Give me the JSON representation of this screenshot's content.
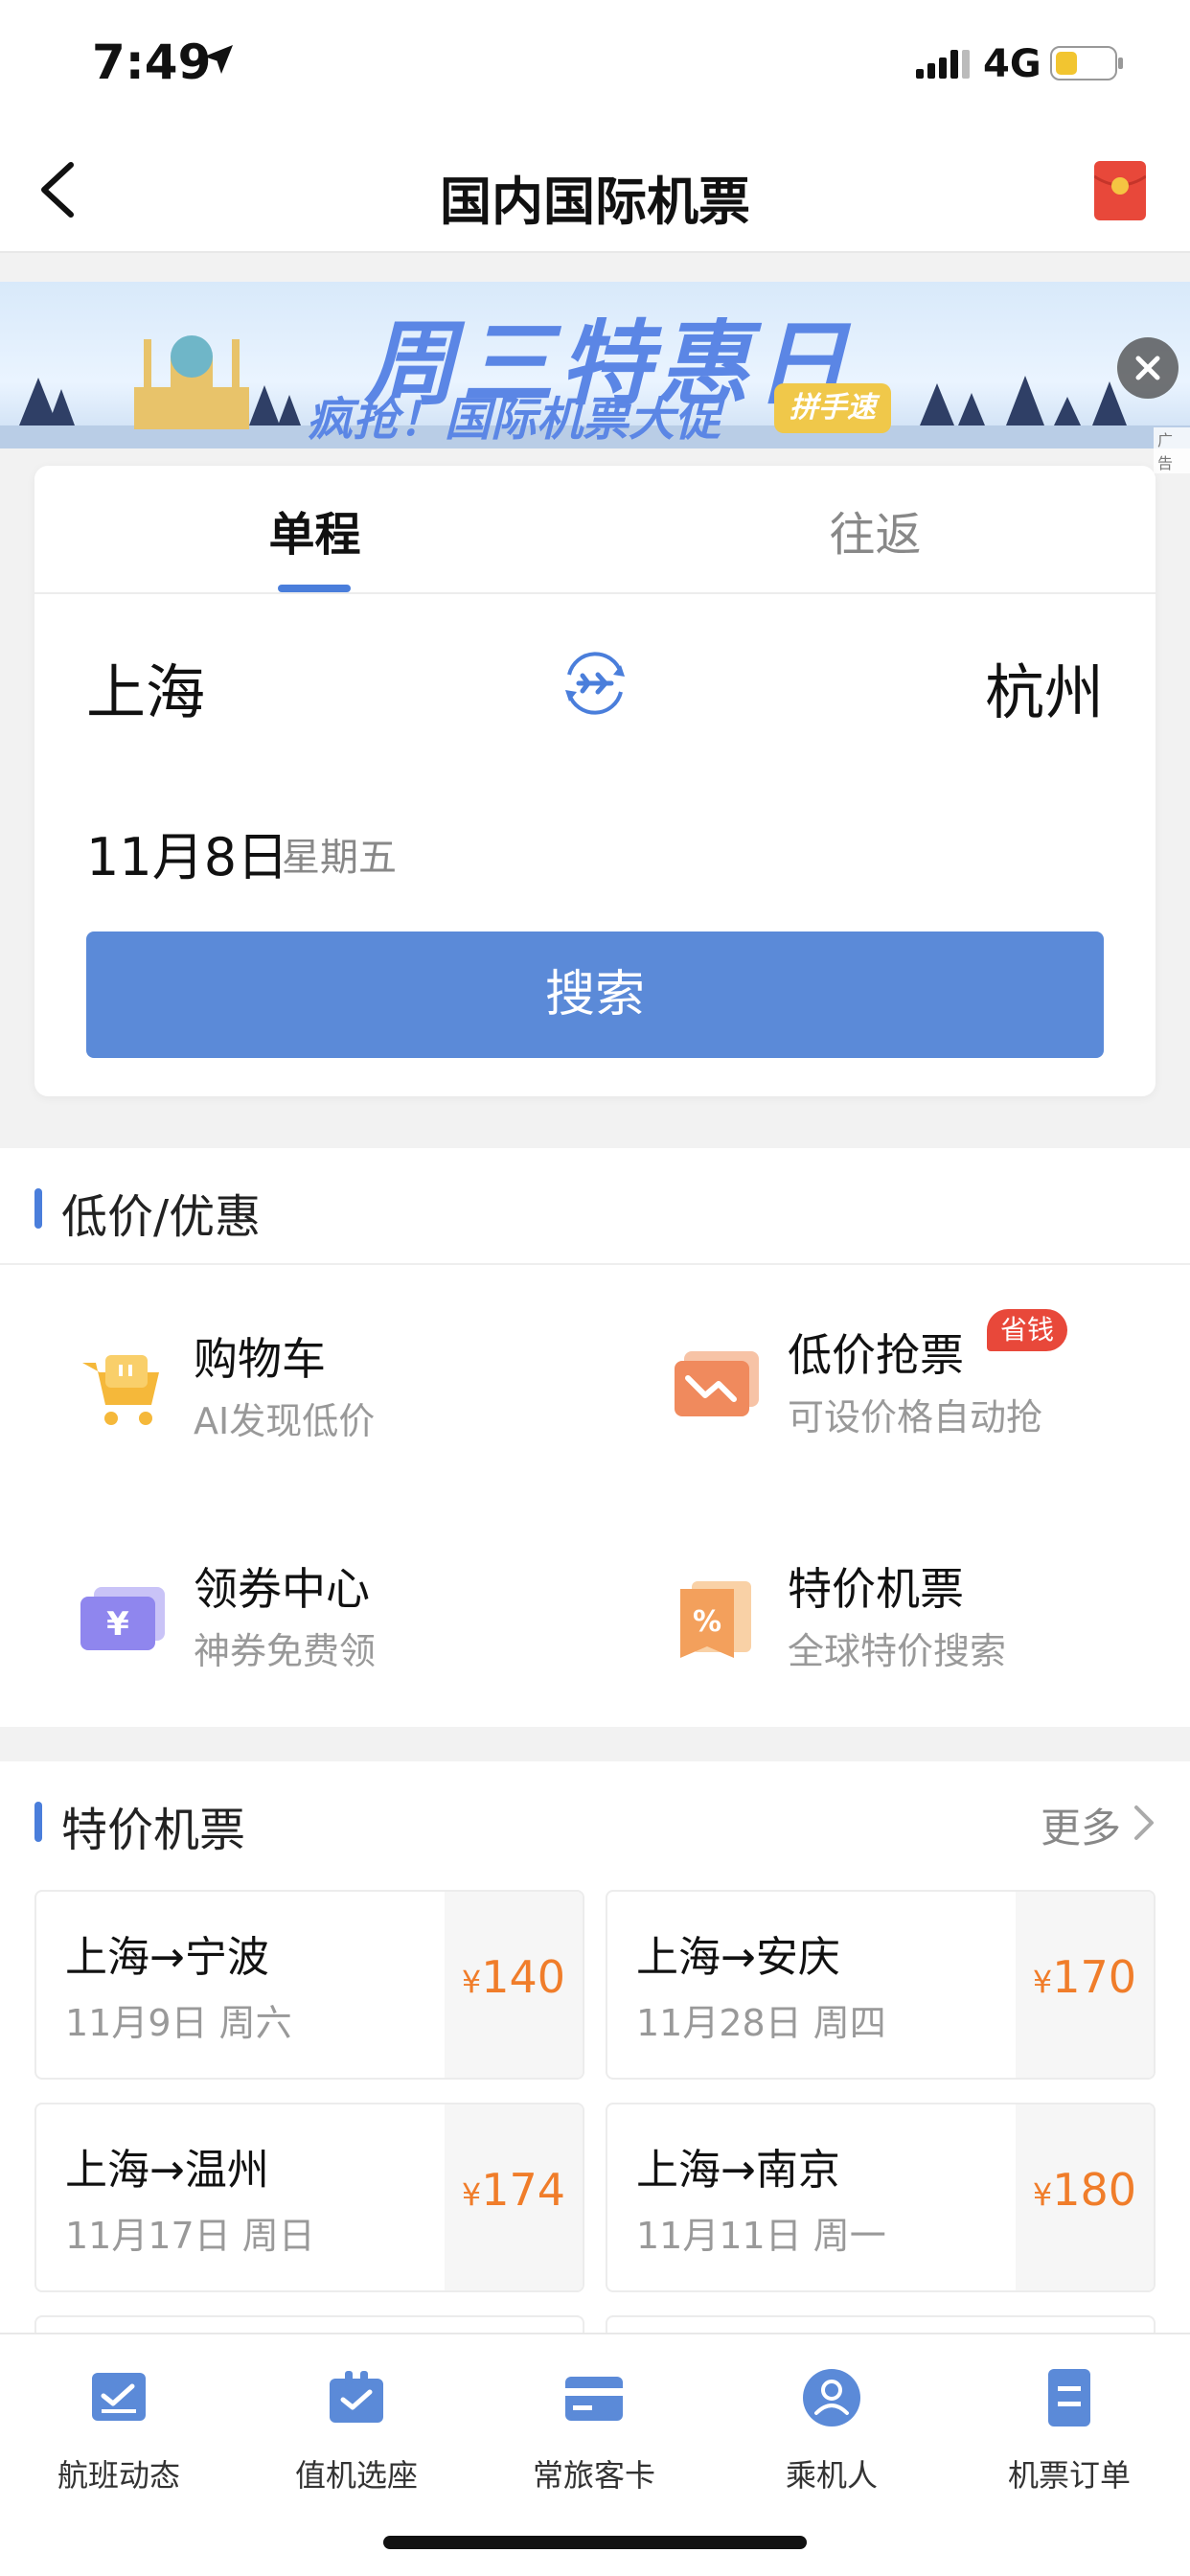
{
  "status_bar": {
    "time": "7:49",
    "network": "4G"
  },
  "nav": {
    "title": "国内国际机票"
  },
  "banner": {
    "title": "周三特惠日",
    "subtitle": "疯抢！国际机票大促",
    "badge": "拼手速",
    "ad_tag": "广告"
  },
  "search": {
    "tabs": [
      "单程",
      "往返"
    ],
    "active_tab": "单程",
    "from_city": "上海",
    "to_city": "杭州",
    "date": "11月8日",
    "weekday": "星期五",
    "button_label": "搜索"
  },
  "promo": {
    "title": "低价/优惠",
    "items": [
      {
        "title": "购物车",
        "subtitle": "AI发现低价",
        "icon": "shopping-cart-icon"
      },
      {
        "title": "低价抢票",
        "subtitle": "可设价格自动抢",
        "badge": "省钱",
        "icon": "price-drop-icon"
      },
      {
        "title": "领券中心",
        "subtitle": "神券免费领",
        "icon": "coupon-icon"
      },
      {
        "title": "特价机票",
        "subtitle": "全球特价搜索",
        "icon": "discount-ticket-icon"
      }
    ]
  },
  "deals": {
    "title": "特价机票",
    "more_label": "更多",
    "items": [
      {
        "route": "上海→宁波",
        "date": "11月9日  周六",
        "currency": "¥",
        "price": "140"
      },
      {
        "route": "上海→安庆",
        "date": "11月28日  周四",
        "currency": "¥",
        "price": "170"
      },
      {
        "route": "上海→温州",
        "date": "11月17日  周日",
        "currency": "¥",
        "price": "174"
      },
      {
        "route": "上海→南京",
        "date": "11月11日  周一",
        "currency": "¥",
        "price": "180"
      }
    ]
  },
  "tabbar": {
    "items": [
      {
        "label": "航班动态",
        "icon": "flight-status-icon"
      },
      {
        "label": "值机选座",
        "icon": "check-in-seat-icon"
      },
      {
        "label": "常旅客卡",
        "icon": "frequent-flyer-card-icon"
      },
      {
        "label": "乘机人",
        "icon": "passenger-icon"
      },
      {
        "label": "机票订单",
        "icon": "ticket-order-icon"
      }
    ]
  },
  "colors": {
    "accent": "#5b8ad8",
    "price": "#f07d2a",
    "badge": "#e8483a"
  }
}
